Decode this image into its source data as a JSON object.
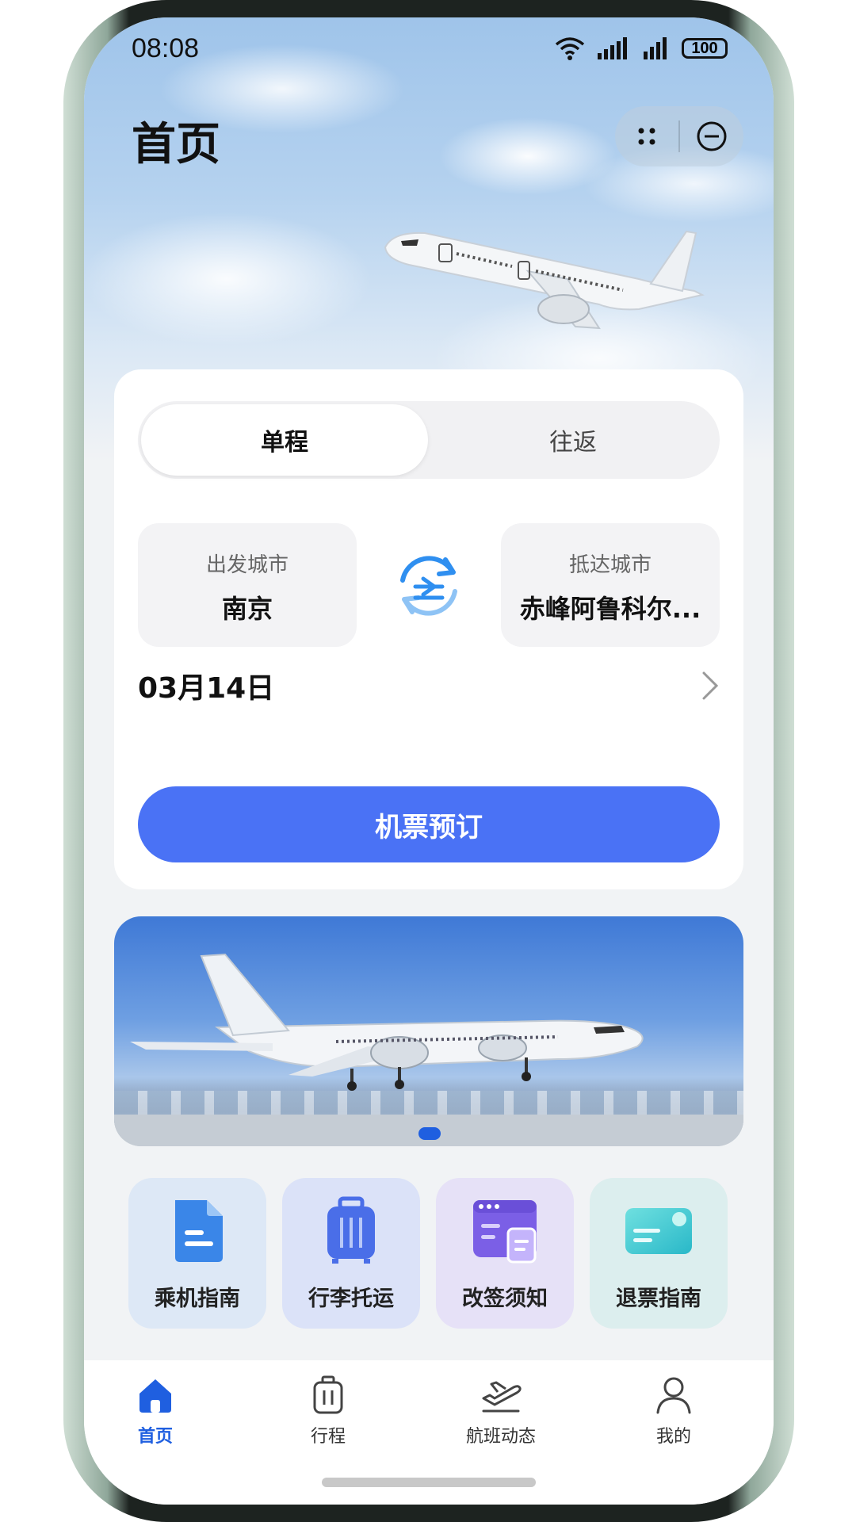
{
  "status_bar": {
    "time": "08:08",
    "battery": "100"
  },
  "header": {
    "title": "首页"
  },
  "booking": {
    "trip_types": [
      "单程",
      "往返"
    ],
    "active_trip_type": "单程",
    "departure": {
      "label": "出发城市",
      "city": "南京"
    },
    "arrival": {
      "label": "抵达城市",
      "city": "赤峰阿鲁科尔..."
    },
    "date": "03月14日",
    "book_label": "机票预订"
  },
  "services": [
    {
      "label": "乘机指南",
      "icon": "document-icon"
    },
    {
      "label": "行李托运",
      "icon": "luggage-icon"
    },
    {
      "label": "改签须知",
      "icon": "window-doc-icon"
    },
    {
      "label": "退票指南",
      "icon": "card-icon"
    }
  ],
  "tabbar": {
    "items": [
      {
        "label": "首页",
        "icon": "home-icon",
        "active": true
      },
      {
        "label": "行程",
        "icon": "suitcase-icon",
        "active": false
      },
      {
        "label": "航班动态",
        "icon": "plane-takeoff-icon",
        "active": false
      },
      {
        "label": "我的",
        "icon": "person-icon",
        "active": false
      }
    ]
  },
  "colors": {
    "accent": "#4a72f5",
    "tab_active": "#1f5fe0"
  }
}
